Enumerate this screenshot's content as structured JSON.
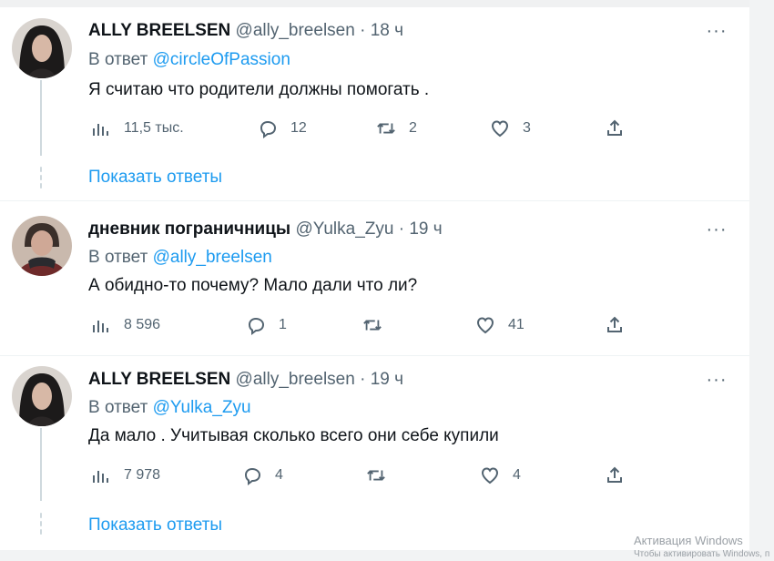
{
  "tweets": [
    {
      "name": "ALLY BREELSEN",
      "handle": "@ally_breelsen",
      "separator": "·",
      "time": "18 ч",
      "reply_prefix": "В ответ",
      "reply_to": "@circleOfPassion",
      "text": "Я считаю что родители должны помогать .",
      "views": "11,5 тыс.",
      "replies": "12",
      "retweets": "2",
      "likes": "3",
      "show_replies": "Показать ответы"
    },
    {
      "name": "дневник пограничницы",
      "handle": "@Yulka_Zyu",
      "separator": "·",
      "time": "19 ч",
      "reply_prefix": "В ответ",
      "reply_to": "@ally_breelsen",
      "text": "А обидно-то почему? Мало дали что ли?",
      "views": "8 596",
      "replies": "1",
      "retweets": "",
      "likes": "41"
    },
    {
      "name": "ALLY BREELSEN",
      "handle": "@ally_breelsen",
      "separator": "·",
      "time": "19 ч",
      "reply_prefix": "В ответ",
      "reply_to": "@Yulka_Zyu",
      "text": "Да мало . Учитывая сколько всего они себе купили",
      "views": "7 978",
      "replies": "4",
      "retweets": "",
      "likes": "4",
      "show_replies": "Показать ответы"
    }
  ],
  "more_glyph": "···",
  "icons": {
    "views": "bar-chart-icon",
    "reply": "speech-bubble-icon",
    "retweet": "retweet-arrows-icon",
    "like": "heart-icon",
    "share": "share-upload-icon",
    "more": "more-dots-icon"
  },
  "watermark": {
    "line1": "Активация Windows",
    "line2": "Чтобы активировать Windows, п"
  },
  "colors": {
    "link": "#1d9bf0",
    "muted": "#536471",
    "text": "#0f1419",
    "thread_line": "#cfd9de"
  }
}
